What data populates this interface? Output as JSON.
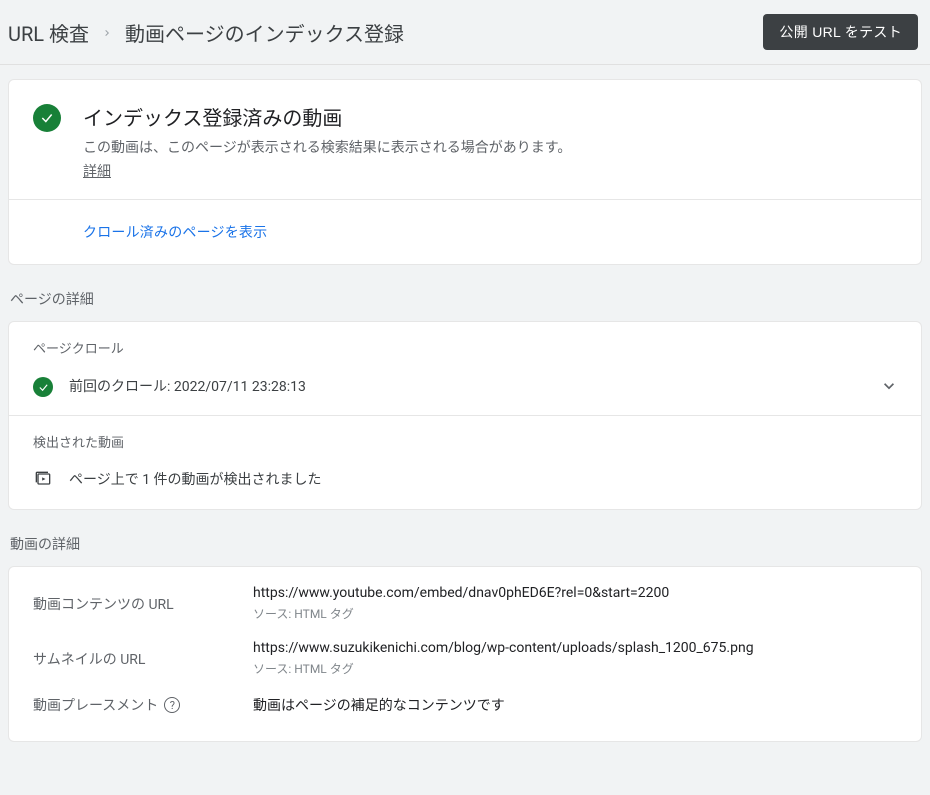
{
  "breadcrumb": {
    "root": "URL 検査",
    "current": "動画ページのインデックス登録"
  },
  "test_button": "公開 URL をテスト",
  "status": {
    "title": "インデックス登録済みの動画",
    "description": "この動画は、このページが表示される検索結果に表示される場合があります。",
    "details_link": "詳細"
  },
  "action": {
    "view_crawled": "クロール済みのページを表示"
  },
  "page_details": {
    "section_label": "ページの詳細",
    "crawl": {
      "label": "ページクロール",
      "last_crawl_prefix": "前回のクロール: ",
      "last_crawl_ts": "2022/07/11 23:28:13"
    },
    "detected": {
      "label": "検出された動画",
      "count_text": "ページ上で 1 件の動画が検出されました"
    }
  },
  "video_details": {
    "section_label": "動画の詳細",
    "rows": {
      "content_url": {
        "label": "動画コンテンツの URL",
        "value": "https://www.youtube.com/embed/dnav0phED6E?rel=0&start=2200",
        "source": "ソース: HTML タグ"
      },
      "thumbnail_url": {
        "label": "サムネイルの URL",
        "value": "https://www.suzukikenichi.com/blog/wp-content/uploads/splash_1200_675.png",
        "source": "ソース: HTML タグ"
      },
      "placement": {
        "label": "動画プレースメント",
        "value": "動画はページの補足的なコンテンツです"
      }
    }
  }
}
